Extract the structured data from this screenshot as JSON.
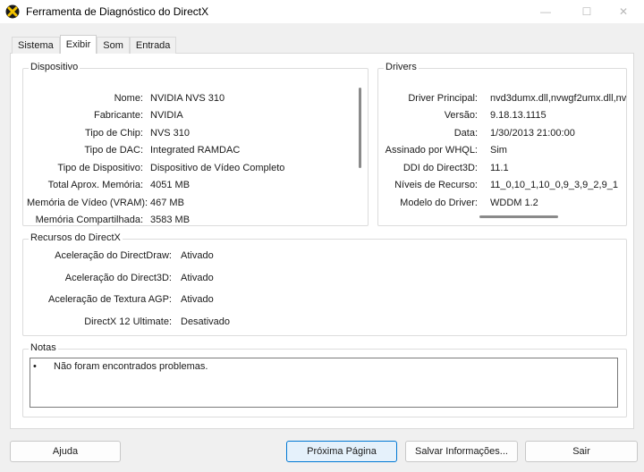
{
  "window": {
    "title": "Ferramenta de Diagnóstico do DirectX",
    "icon": "directx-x-icon",
    "controls": {
      "minimize": "—",
      "maximize": "☐",
      "close": "✕"
    }
  },
  "tabs": [
    {
      "label": "Sistema",
      "active": false
    },
    {
      "label": "Exibir",
      "active": true
    },
    {
      "label": "Som",
      "active": false
    },
    {
      "label": "Entrada",
      "active": false
    }
  ],
  "device": {
    "title": "Dispositivo",
    "rows": [
      {
        "label": "Nome:",
        "value": "NVIDIA NVS 310"
      },
      {
        "label": "Fabricante:",
        "value": "NVIDIA"
      },
      {
        "label": "Tipo de Chip:",
        "value": "NVS 310"
      },
      {
        "label": "Tipo de DAC:",
        "value": "Integrated RAMDAC"
      },
      {
        "label": "Tipo de Dispositivo:",
        "value": "Dispositivo de Vídeo Completo"
      },
      {
        "label": "Total Aprox. Memória:",
        "value": "4051 MB"
      },
      {
        "label": "Memória de Vídeo (VRAM):",
        "value": "467 MB"
      },
      {
        "label": "Memória Compartilhada:",
        "value": "3583 MB"
      }
    ]
  },
  "drivers": {
    "title": "Drivers",
    "rows": [
      {
        "label": "Driver Principal:",
        "value": "nvd3dumx.dll,nvwgf2umx.dll,nv"
      },
      {
        "label": "Versão:",
        "value": "9.18.13.1115"
      },
      {
        "label": "Data:",
        "value": "1/30/2013 21:00:00"
      },
      {
        "label": "Assinado por WHQL:",
        "value": "Sim"
      },
      {
        "label": "DDI do Direct3D:",
        "value": "11.1"
      },
      {
        "label": "Níveis de Recurso:",
        "value": "11_0,10_1,10_0,9_3,9_2,9_1"
      },
      {
        "label": "Modelo do Driver:",
        "value": "WDDM 1.2"
      }
    ]
  },
  "directx": {
    "title": "Recursos do DirectX",
    "rows": [
      {
        "label": "Aceleração do DirectDraw:",
        "value": "Ativado"
      },
      {
        "label": "Aceleração do Direct3D:",
        "value": "Ativado"
      },
      {
        "label": "Aceleração de Textura AGP:",
        "value": "Ativado"
      },
      {
        "label": "DirectX 12 Ultimate:",
        "value": "Desativado"
      }
    ]
  },
  "notes": {
    "title": "Notas",
    "bullet": "•",
    "text": "Não foram encontrados problemas."
  },
  "buttons": {
    "help": "Ajuda",
    "next_page": "Próxima Página",
    "save_info": "Salvar Informações...",
    "exit": "Sair"
  }
}
